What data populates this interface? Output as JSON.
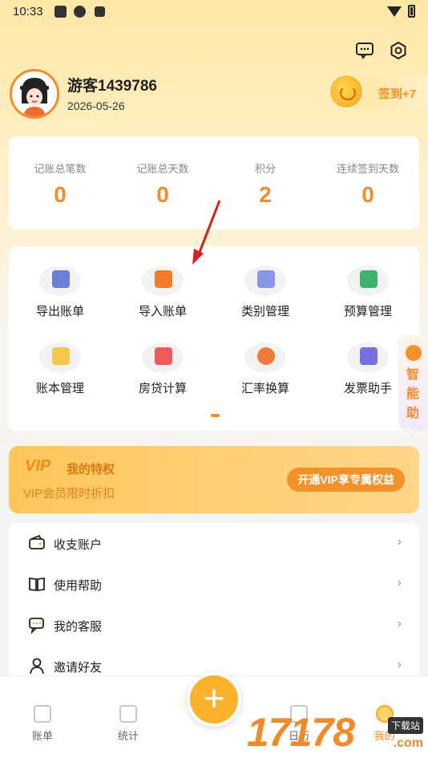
{
  "status_bar": {
    "time": "10:33"
  },
  "profile": {
    "username": "游客1439786",
    "date": "2026-05-26"
  },
  "checkin": {
    "label": "签到+7"
  },
  "stats": [
    {
      "label": "记账总笔数",
      "value": "0"
    },
    {
      "label": "记账总天数",
      "value": "0"
    },
    {
      "label": "积分",
      "value": "2"
    },
    {
      "label": "连续签到天数",
      "value": "0"
    }
  ],
  "tools": [
    {
      "label": "导出账单",
      "icon": "export-bill-icon",
      "color": "#6b7fd7"
    },
    {
      "label": "导入账单",
      "icon": "import-bill-icon",
      "color": "#f07b2a"
    },
    {
      "label": "类别管理",
      "icon": "category-icon",
      "color": "#8a95e8"
    },
    {
      "label": "预算管理",
      "icon": "budget-icon",
      "color": "#3fb36b"
    },
    {
      "label": "账本管理",
      "icon": "ledger-icon",
      "color": "#f7c94a"
    },
    {
      "label": "房贷计算",
      "icon": "mortgage-calculator-icon",
      "color": "#ef5b5b"
    },
    {
      "label": "汇率换算",
      "icon": "exchange-rate-icon",
      "color": "#f27a3a"
    },
    {
      "label": "发票助手",
      "icon": "invoice-icon",
      "color": "#7a6fe0"
    }
  ],
  "side_tab": {
    "label": "智能助"
  },
  "vip": {
    "logo": "VIP",
    "title": "我的特权",
    "subtitle": "VIP会员限时折扣",
    "button": "开通VIP享专属权益"
  },
  "menu": [
    {
      "label": "收支账户",
      "icon": "wallet-icon"
    },
    {
      "label": "使用帮助",
      "icon": "book-icon"
    },
    {
      "label": "我的客服",
      "icon": "chat-icon"
    },
    {
      "label": "邀请好友",
      "icon": "person-icon"
    }
  ],
  "nav": [
    {
      "label": "账单",
      "icon": "bill-icon"
    },
    {
      "label": "统计",
      "icon": "stats-icon"
    },
    {
      "label": "日历",
      "icon": "calendar-icon"
    },
    {
      "label": "我的",
      "icon": "my-icon"
    }
  ],
  "fab": {
    "symbol": "+"
  },
  "watermark": {
    "text": "17178",
    "badge": "下载站",
    "sub": ".com"
  },
  "colors": {
    "accent": "#f28b2c",
    "fab": "#fdb22e"
  }
}
